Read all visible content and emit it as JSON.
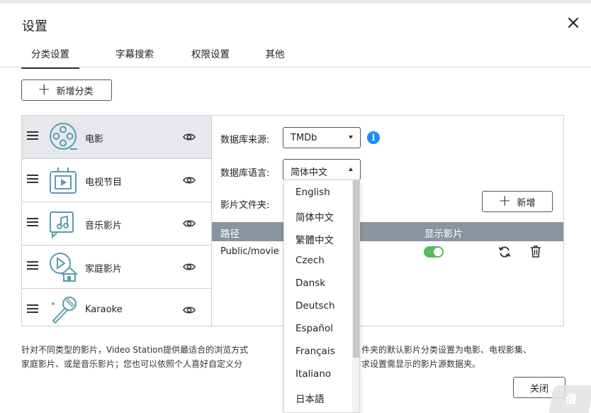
{
  "dialog": {
    "title": "设置",
    "close_icon": "close-icon"
  },
  "tabs": [
    {
      "label": "分类设置",
      "active": true
    },
    {
      "label": "字幕搜索",
      "active": false
    },
    {
      "label": "权限设置",
      "active": false
    },
    {
      "label": "其他",
      "active": false
    }
  ],
  "toolbar": {
    "add_category_label": "新增分类"
  },
  "categories": [
    {
      "label": "电影",
      "icon": "film-reel-icon",
      "selected": true,
      "visible_icon": "eye-icon"
    },
    {
      "label": "电视节目",
      "icon": "tv-icon",
      "selected": false,
      "visible_icon": "eye-icon"
    },
    {
      "label": "音乐影片",
      "icon": "music-video-icon",
      "selected": false,
      "visible_icon": "eye-icon"
    },
    {
      "label": "家庭影片",
      "icon": "home-video-icon",
      "selected": false,
      "visible_icon": "eye-icon"
    },
    {
      "label": "Karaoke",
      "icon": "microphone-icon",
      "selected": false,
      "visible_icon": "eye-icon"
    }
  ],
  "settings": {
    "source_label": "数据库来源:",
    "source_value": "TMDb",
    "info_icon": "info-icon",
    "language_label": "数据库语言:",
    "language_value": "简体中文",
    "folder_label": "影片文件夹:",
    "add_folder_label": "新增"
  },
  "folder_table": {
    "columns": [
      "路径",
      "显示影片"
    ],
    "rows": [
      {
        "path": "Public/movie",
        "show": true,
        "refresh_icon": "refresh-icon",
        "delete_icon": "trash-icon"
      }
    ]
  },
  "language_dropdown": {
    "options": [
      "English",
      "简体中文",
      "繁體中文",
      "Czech",
      "Dansk",
      "Deutsch",
      "Español",
      "Français",
      "Italiano",
      "日本語"
    ]
  },
  "description": {
    "line1a": "针对不同类型的影片，Video Station提供最适合的浏览方式",
    "line1b": "件夹的默认影片分类设置为电影、电视影集、",
    "line2a": "家庭影片、或是音乐影片；您也可以依照个人喜好自定义分",
    "line2b": "求设置需显示的影片源数据夹。"
  },
  "footer": {
    "close_label": "关闭"
  },
  "colors": {
    "accent_blue": "#1a8ef5",
    "toggle_green": "#5cb85c",
    "header_gray": "#8a949f",
    "icon_teal": "#5b9bb0"
  }
}
